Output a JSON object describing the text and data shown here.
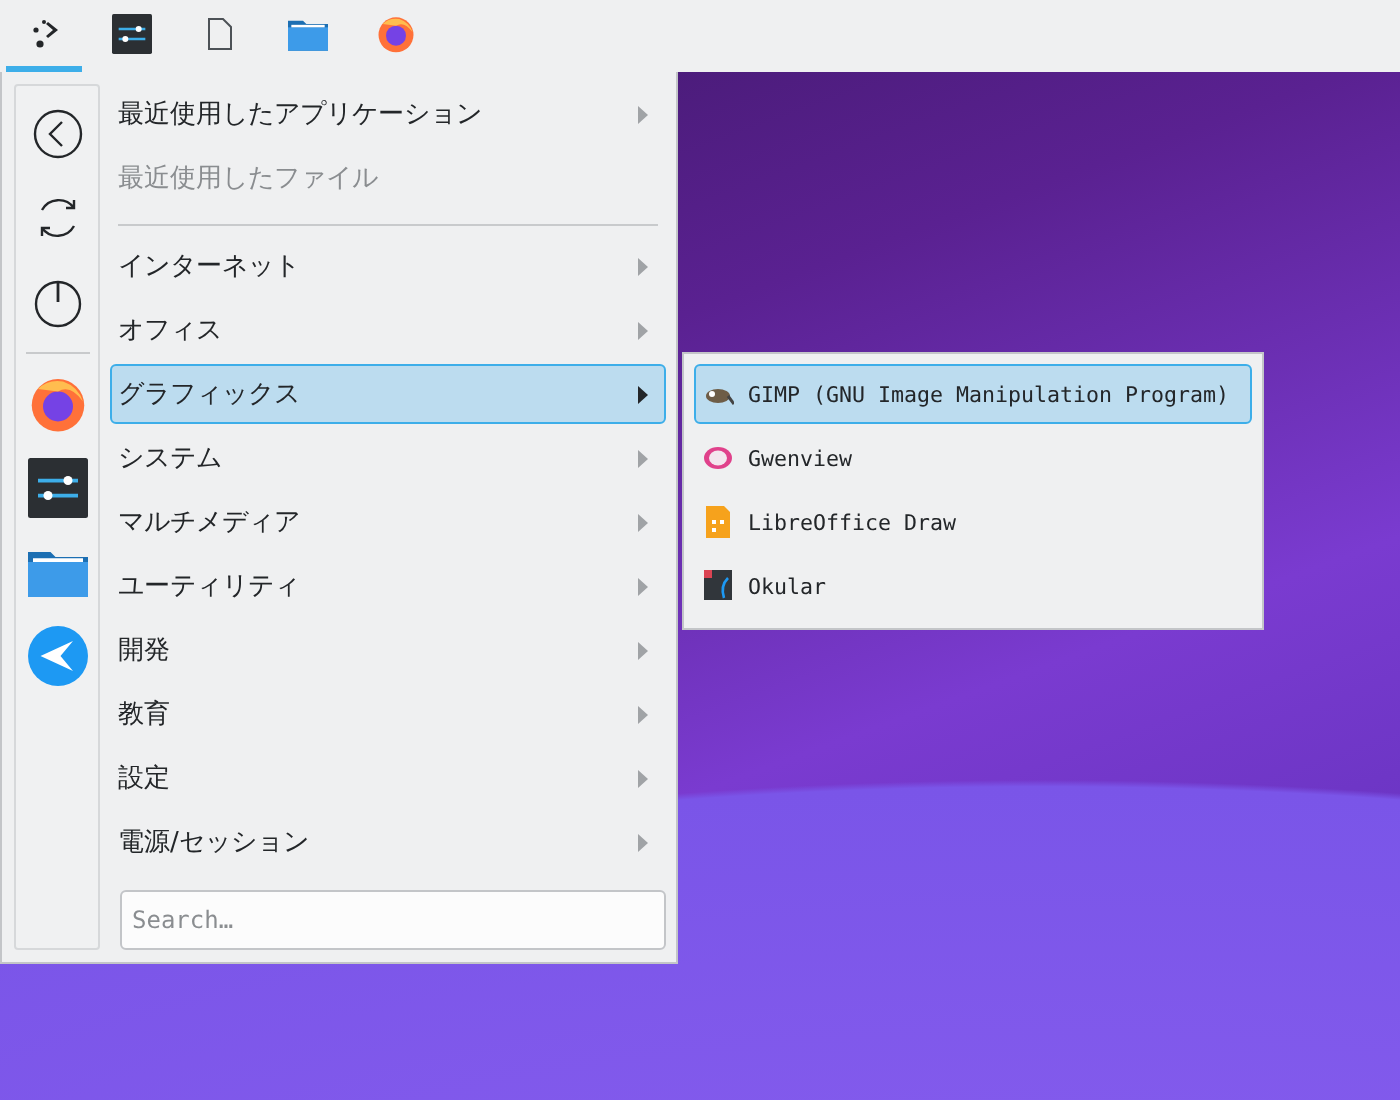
{
  "taskbar": {
    "items": [
      {
        "kind": "launcher",
        "selected": true
      },
      {
        "kind": "settings",
        "selected": false
      },
      {
        "kind": "file",
        "selected": false
      },
      {
        "kind": "folder",
        "selected": false
      },
      {
        "kind": "browser",
        "selected": false
      }
    ]
  },
  "sidebar": {
    "actions": [
      {
        "kind": "back"
      },
      {
        "kind": "refresh"
      },
      {
        "kind": "power"
      }
    ],
    "favorites": [
      {
        "kind": "browser"
      },
      {
        "kind": "settings"
      },
      {
        "kind": "folder"
      },
      {
        "kind": "plane"
      }
    ]
  },
  "menu": {
    "items": [
      {
        "kind": "entry",
        "label": "最近使用したアプリケーション",
        "disabled": false,
        "selected": false,
        "submenu": true
      },
      {
        "kind": "entry",
        "label": "最近使用したファイル",
        "disabled": true,
        "selected": false,
        "submenu": false
      },
      {
        "kind": "separator"
      },
      {
        "kind": "entry",
        "label": "インターネット",
        "disabled": false,
        "selected": false,
        "submenu": true
      },
      {
        "kind": "entry",
        "label": "オフィス",
        "disabled": false,
        "selected": false,
        "submenu": true
      },
      {
        "kind": "entry",
        "label": "グラフィックス",
        "disabled": false,
        "selected": true,
        "submenu": true
      },
      {
        "kind": "entry",
        "label": "システム",
        "disabled": false,
        "selected": false,
        "submenu": true
      },
      {
        "kind": "entry",
        "label": "マルチメディア",
        "disabled": false,
        "selected": false,
        "submenu": true
      },
      {
        "kind": "entry",
        "label": "ユーティリティ",
        "disabled": false,
        "selected": false,
        "submenu": true
      },
      {
        "kind": "entry",
        "label": "開発",
        "disabled": false,
        "selected": false,
        "submenu": true
      },
      {
        "kind": "entry",
        "label": "教育",
        "disabled": false,
        "selected": false,
        "submenu": true
      },
      {
        "kind": "entry",
        "label": "設定",
        "disabled": false,
        "selected": false,
        "submenu": true
      },
      {
        "kind": "entry",
        "label": "電源/セッション",
        "disabled": false,
        "selected": false,
        "submenu": true
      }
    ],
    "search": {
      "placeholder": "Search…"
    }
  },
  "submenu": {
    "items": [
      {
        "kind": "gimp",
        "label": "GIMP (GNU Image Manipulation Program)",
        "selected": true
      },
      {
        "kind": "gwenview",
        "label": "Gwenview",
        "selected": false
      },
      {
        "kind": "draw",
        "label": "LibreOffice Draw",
        "selected": false
      },
      {
        "kind": "okular",
        "label": "Okular",
        "selected": false
      }
    ]
  }
}
